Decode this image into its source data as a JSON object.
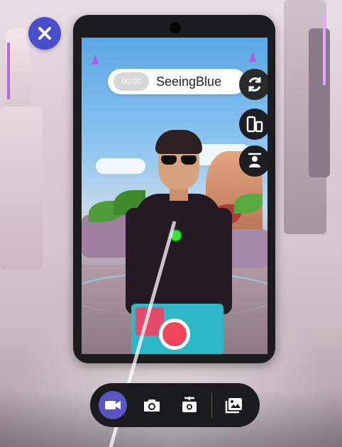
{
  "window": {
    "title": "SeeingBlue"
  },
  "camera": {
    "title": "SeeingBlue",
    "timer": "00:00",
    "record_state": "idle"
  },
  "controls": {
    "close": "close-icon",
    "flip": "refresh-icon",
    "orientation": "phone-orientation-icon",
    "person_frame": "person-frame-icon"
  },
  "toolbar": {
    "items": [
      {
        "name": "video",
        "icon": "video-camera-icon",
        "active": true
      },
      {
        "name": "photo",
        "icon": "camera-icon",
        "active": false
      },
      {
        "name": "selfie",
        "icon": "selfie-stick-icon",
        "active": false
      },
      {
        "name": "gallery",
        "icon": "gallery-icon",
        "active": false
      }
    ]
  },
  "colors": {
    "accent": "#5a55c7",
    "record": "#f0445b",
    "close_bg": "#4a4fc9"
  }
}
